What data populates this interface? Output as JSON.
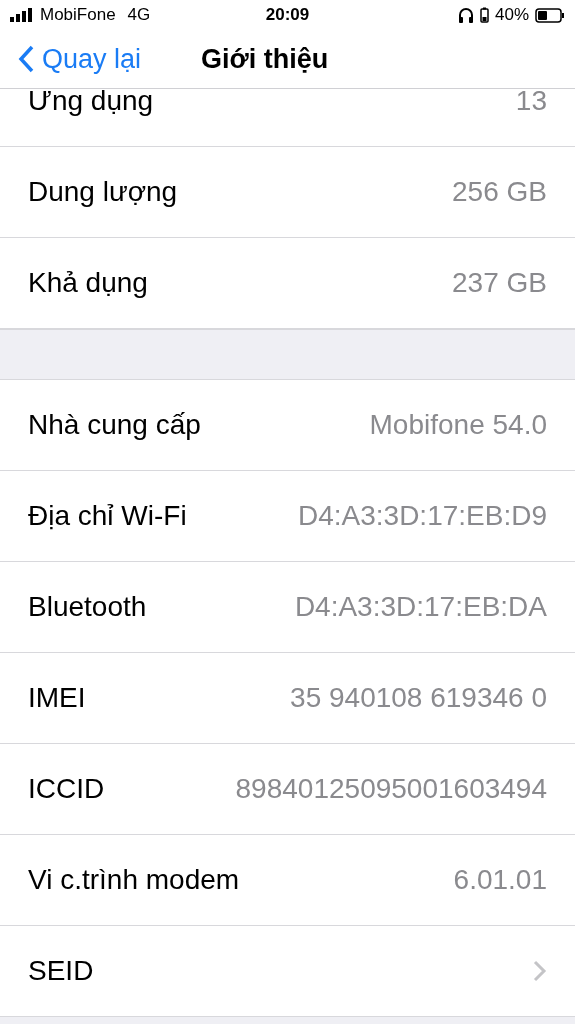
{
  "status_bar": {
    "carrier": "MobiFone",
    "network": "4G",
    "time": "20:09",
    "battery": "40%"
  },
  "nav": {
    "back": "Quay lại",
    "title": "Giới thiệu"
  },
  "groups": [
    [
      {
        "label": "Ứng dụng",
        "value": "13",
        "kind": "value",
        "cut_off": true
      },
      {
        "label": "Dung lượng",
        "value": "256 GB",
        "kind": "value",
        "cut_off": false
      },
      {
        "label": "Khả dụng",
        "value": "237 GB",
        "kind": "value",
        "cut_off": false
      }
    ],
    [
      {
        "label": "Nhà cung cấp",
        "value": "Mobifone 54.0",
        "kind": "value",
        "cut_off": false
      },
      {
        "label": "Địa chỉ Wi-Fi",
        "value": "D4:A3:3D:17:EB:D9",
        "kind": "value",
        "cut_off": false
      },
      {
        "label": "Bluetooth",
        "value": "D4:A3:3D:17:EB:DA",
        "kind": "value",
        "cut_off": false
      },
      {
        "label": "IMEI",
        "value": "35 940108 619346 0",
        "kind": "value",
        "cut_off": false
      },
      {
        "label": "ICCID",
        "value": "89840125095001603494",
        "kind": "value",
        "cut_off": false
      },
      {
        "label": "Vi c.trình modem",
        "value": "6.01.01",
        "kind": "value",
        "cut_off": false
      },
      {
        "label": "SEID",
        "kind": "link",
        "cut_off": false
      }
    ]
  ]
}
